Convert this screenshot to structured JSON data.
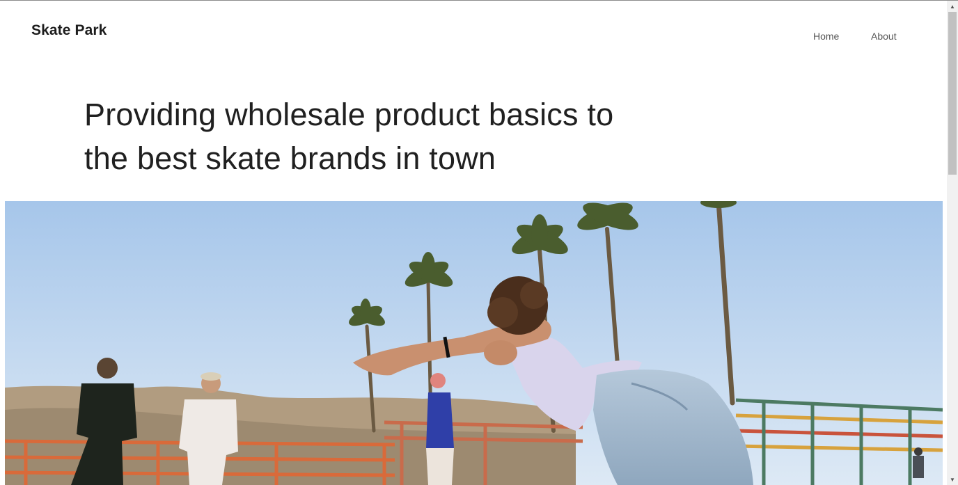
{
  "header": {
    "brand": "Skate Park",
    "nav": [
      {
        "label": "Home"
      },
      {
        "label": "About"
      }
    ]
  },
  "hero": {
    "title_line1": "Providing wholesale product basics to",
    "title_line2": "the best skate brands in town"
  },
  "colors": {
    "sky_top": "#a9c8ea",
    "sky_bottom": "#dbe8f5",
    "hills": "#a99379",
    "fence": "#d96a3a",
    "text": "#202020",
    "nav_text": "#555555"
  },
  "icons": [
    "scroll-up-arrow-icon",
    "scroll-down-arrow-icon"
  ]
}
